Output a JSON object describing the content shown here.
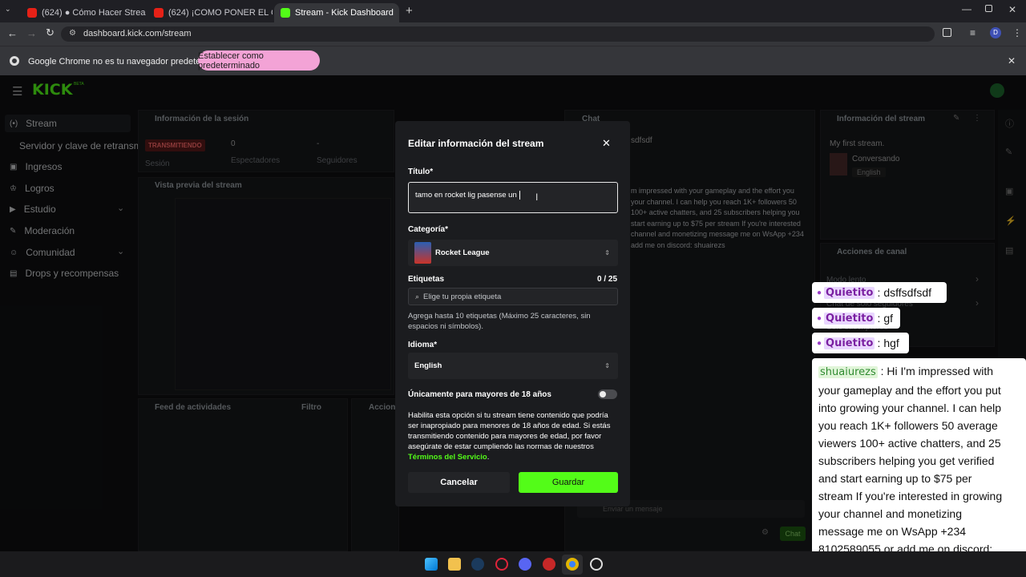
{
  "browser": {
    "tabs": [
      {
        "label": "(624) ● Cómo Hacer Streams -",
        "icon": "youtube-icon"
      },
      {
        "label": "(624) ¡COMO PONER EL CHAT E",
        "icon": "youtube-icon"
      },
      {
        "label": "Stream - Kick Dashboard",
        "icon": "kick-icon"
      }
    ],
    "url": "dashboard.kick.com/stream",
    "profile_initial": "D",
    "infobar_text": "Google Chrome no es tu navegador predeterminado",
    "infobar_button": "Establecer como predeterminado"
  },
  "dashboard": {
    "logo": "KICK",
    "logo_badge": "BETA",
    "nav": [
      {
        "label": "Stream",
        "icon": "broadcast-icon"
      },
      {
        "label": "Servidor y clave de retransm",
        "icon": ""
      },
      {
        "label": "Ingresos",
        "icon": "dollar-icon"
      },
      {
        "label": "Logros",
        "icon": "trophy-icon"
      },
      {
        "label": "Estudio",
        "icon": "video-icon"
      },
      {
        "label": "Moderación",
        "icon": "wrench-icon"
      },
      {
        "label": "Comunidad",
        "icon": "people-icon"
      },
      {
        "label": "Drops y recompensas",
        "icon": "gift-icon"
      }
    ],
    "session": {
      "title": "Información de la sesión",
      "status": "TRANSMITIENDO",
      "viewers_value": "0",
      "followers_value": "-",
      "col_session": "Sesión",
      "col_viewers": "Espectadores",
      "col_followers": "Seguidores"
    },
    "preview_title": "Vista previa del stream",
    "feed_title": "Feed de actividades",
    "feed_filter": "Filtro",
    "actions_short": "Accione",
    "chat_title": "Chat",
    "chat_fragment": "sdfsdf",
    "chat_message_lines": [
      "m impressed with your gameplay and the effort you",
      "your channel. I can help you reach 1K+ followers 50",
      "100+ active chatters, and 25 subscribers helping you",
      "start earning up to $75 per stream If you're interested",
      "channel and monetizing message me on WsApp +234",
      "add me on discord: shuairezs"
    ],
    "chat_input_placeholder": "Enviar un mensaje",
    "chat_send": "Chat",
    "stream_info": {
      "title": "Información del stream",
      "stream_name": "My first stream.",
      "category": "Conversando",
      "language": "English"
    },
    "channel_actions": {
      "title": "Acciones de canal",
      "items": [
        "Modo lento",
        "Chat de solo seguidores",
        "Solo suscriptores"
      ]
    }
  },
  "modal": {
    "title": "Editar información del stream",
    "title_label": "Título*",
    "title_value": "tamo en rocket lig pasense un",
    "category_label": "Categoría*",
    "category_value": "Rocket League",
    "tags_label": "Etiquetas",
    "tags_count": "0 / 25",
    "tags_placeholder": "Elige tu propia etiqueta",
    "tags_help": "Agrega hasta 10 etiquetas (Máximo 25 caracteres, sin espacios ni símbolos).",
    "language_label": "Idioma*",
    "language_value": "English",
    "adult_label": "Únicamente para mayores de 18 años",
    "adult_enabled": false,
    "adult_help": "Habilita esta opción si tu stream tiene contenido que podría ser inapropiado para menores de 18 años de edad. Si estás transmitiendo contenido para mayores de edad, por favor asegúrate de estar cumpliendo las normas de nuestros",
    "terms_link": "Términos del Servicio",
    "terms_end": ".",
    "cancel": "Cancelar",
    "save": "Guardar",
    "accent": "#53fc18"
  },
  "overlay_chat": [
    {
      "user": "Quietito",
      "sep": ":",
      "text": "dsffsdfsdf"
    },
    {
      "user": "Quietito",
      "sep": ":",
      "text": "gf"
    },
    {
      "user": "Quietito",
      "sep": ":",
      "text": "hgf"
    }
  ],
  "overlay_long": {
    "user": "shuaiurezs",
    "lines": [
      ": Hi I'm impressed with",
      "your gameplay and the effort you put",
      "into growing your channel. I can help",
      "you reach 1K+ followers 50 average",
      "viewers 100+ active chatters, and 25",
      "subscribers helping you get verified",
      "and start earning up to $75 per",
      "stream If you're interested in growing",
      "your channel and monetizing",
      "message me on WsApp +234",
      "8102589055 or add me on discord:",
      "shuairezs"
    ]
  }
}
